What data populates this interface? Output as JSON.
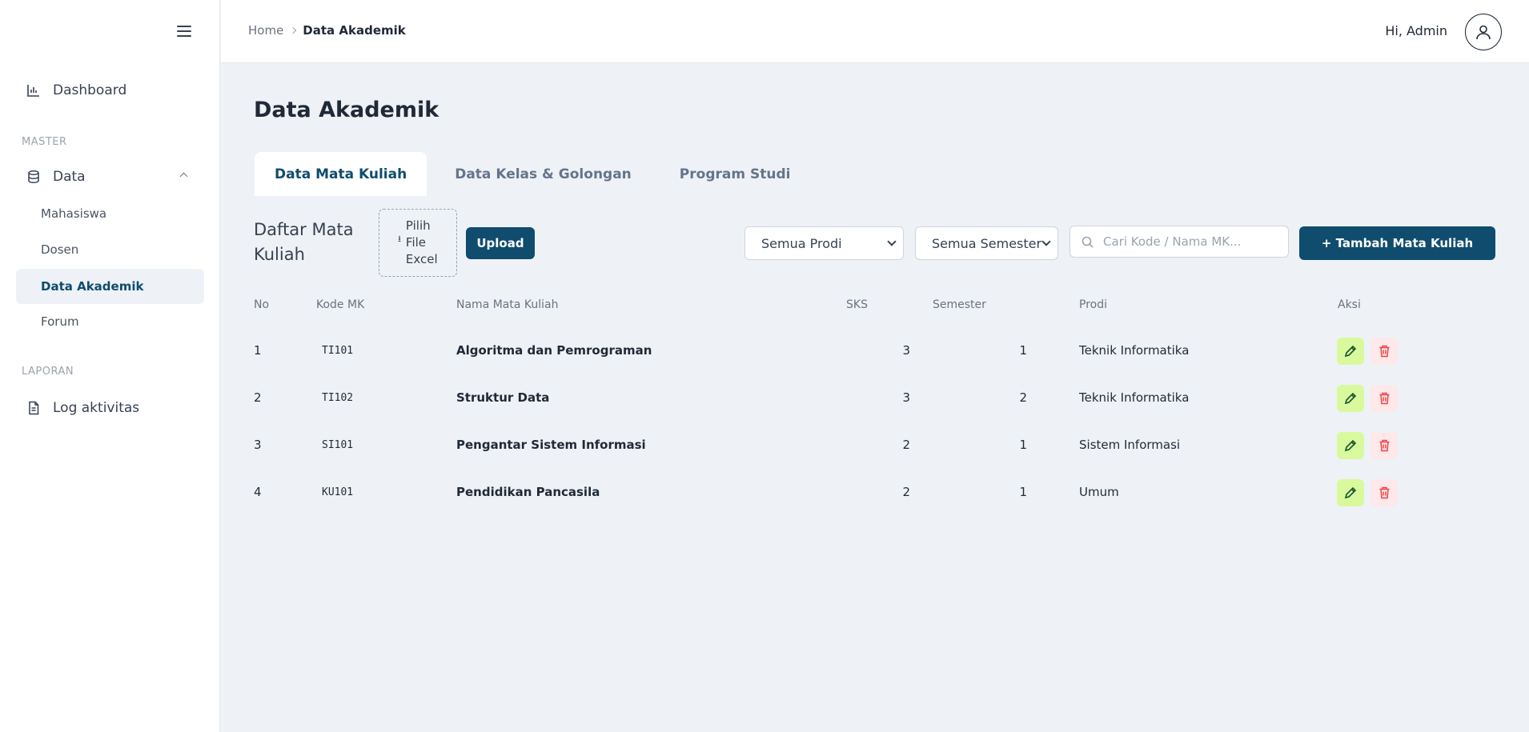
{
  "sidebar": {
    "dashboard": "Dashboard",
    "section_master": "MASTER",
    "data": "Data",
    "sub": [
      "Mahasiswa",
      "Dosen",
      "Data Akademik",
      "Forum"
    ],
    "section_laporan": "LAPORAN",
    "log": "Log aktivitas"
  },
  "breadcrumb": {
    "home": "Home",
    "current": "Data Akademik"
  },
  "user": {
    "greeting": "Hi, Admin"
  },
  "page_title": "Data Akademik",
  "tabs": [
    "Data Mata Kuliah",
    "Data Kelas & Golongan",
    "Program Studi"
  ],
  "toolbar": {
    "list_title": "Daftar Mata Kuliah",
    "file_label": "Pilih File Excel",
    "upload": "Upload",
    "prodi_select": "Semua Prodi",
    "semester_select": "Semua Semester",
    "search_placeholder": "Cari Kode / Nama MK...",
    "add_button": "+ Tambah Mata Kuliah"
  },
  "table": {
    "headers": [
      "No",
      "Kode MK",
      "Nama Mata Kuliah",
      "SKS",
      "Semester",
      "Prodi",
      "Aksi"
    ],
    "rows": [
      [
        "1",
        "TI101",
        "Algoritma dan Pemrograman",
        "3",
        "1",
        "Teknik Informatika"
      ],
      [
        "2",
        "TI102",
        "Struktur Data",
        "3",
        "2",
        "Teknik Informatika"
      ],
      [
        "3",
        "SI101",
        "Pengantar Sistem Informasi",
        "2",
        "1",
        "Sistem Informasi"
      ],
      [
        "4",
        "KU101",
        "Pendidikan Pancasila",
        "2",
        "1",
        "Umum"
      ]
    ]
  },
  "colors": {
    "primary": "#0f4c6e",
    "edit_bg": "#d9f99d",
    "delete_bg": "#fde8ea",
    "delete_icon": "#ef4444",
    "page_bg": "#eef2f6"
  },
  "icons": [
    "menu-icon",
    "chart-icon",
    "database-icon",
    "chevron-up-icon",
    "document-icon",
    "chevron-right-icon",
    "user-icon",
    "upload-icon",
    "search-icon",
    "pencil-icon",
    "trash-icon"
  ]
}
